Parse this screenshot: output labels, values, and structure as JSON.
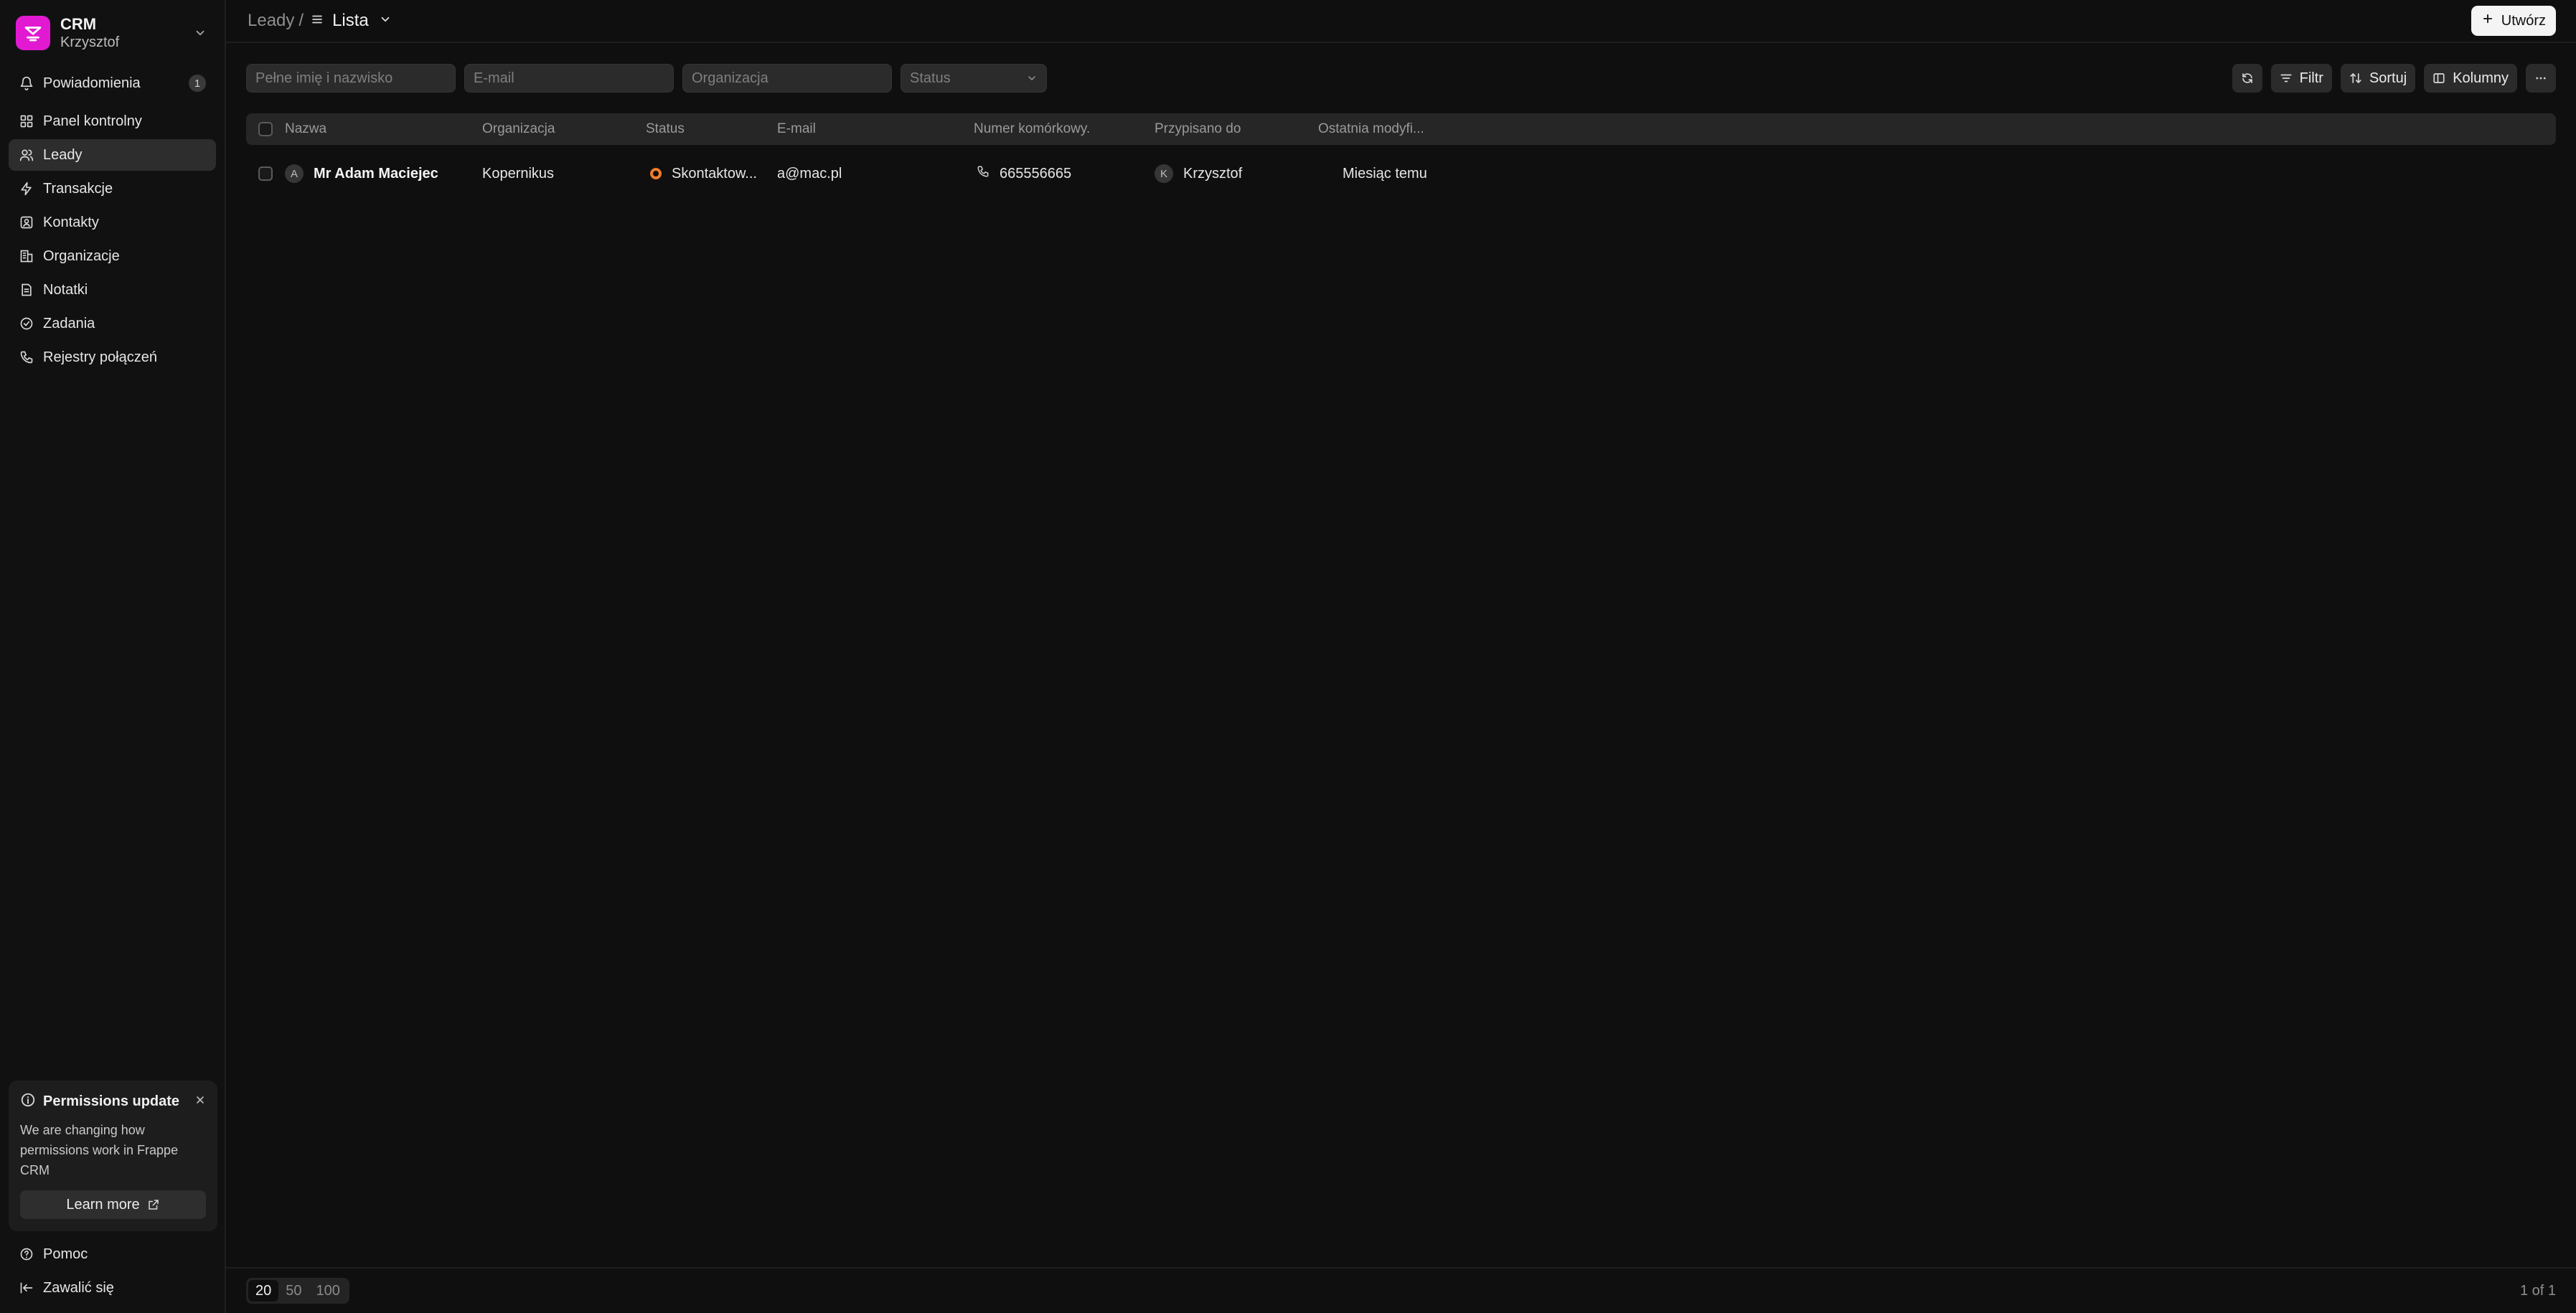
{
  "sidebar": {
    "brand_title": "CRM",
    "brand_user": "Krzysztof",
    "notifications_label": "Powiadomienia",
    "notifications_count": "1",
    "items": [
      {
        "label": "Panel kontrolny",
        "icon": "dashboard-icon"
      },
      {
        "label": "Leady",
        "icon": "users-icon",
        "active": true
      },
      {
        "label": "Transakcje",
        "icon": "lightning-icon"
      },
      {
        "label": "Kontakty",
        "icon": "contact-icon"
      },
      {
        "label": "Organizacje",
        "icon": "building-icon"
      },
      {
        "label": "Notatki",
        "icon": "note-icon"
      },
      {
        "label": "Zadania",
        "icon": "check-circle-icon"
      },
      {
        "label": "Rejestry połączeń",
        "icon": "phone-icon"
      }
    ],
    "permissions_card": {
      "title": "Permissions update",
      "body": "We are changing how permissions work in Frappe CRM",
      "button": "Learn more"
    },
    "help_label": "Pomoc",
    "logout_label": "Zawalić się"
  },
  "header": {
    "breadcrumb_root": "Leady",
    "breadcrumb_sep": "/",
    "view_label": "Lista",
    "create_label": "Utwórz"
  },
  "filters": {
    "name_placeholder": "Pełne imię i nazwisko",
    "email_placeholder": "E-mail",
    "org_placeholder": "Organizacja",
    "status_placeholder": "Status",
    "filter_label": "Filtr",
    "sort_label": "Sortuj",
    "columns_label": "Kolumny"
  },
  "table": {
    "columns": [
      "Nazwa",
      "Organizacja",
      "Status",
      "E-mail",
      "Numer komórkowy.",
      "Przypisano do",
      "Ostatnia modyfi..."
    ],
    "rows": [
      {
        "avatar": "A",
        "name": "Mr Adam Maciejec",
        "organization": "Kopernikus",
        "status": "Skontaktow...",
        "email": "a@mac.pl",
        "phone": "665556665",
        "assigned_avatar": "K",
        "assigned": "Krzysztof",
        "modified": "Miesiąc temu"
      }
    ]
  },
  "footer": {
    "page_sizes": [
      "20",
      "50",
      "100"
    ],
    "page_info": "1 of 1"
  },
  "colors": {
    "brand": "#e11ad2",
    "status_dot": "#f07c2a",
    "background": "#0f0f0f"
  }
}
